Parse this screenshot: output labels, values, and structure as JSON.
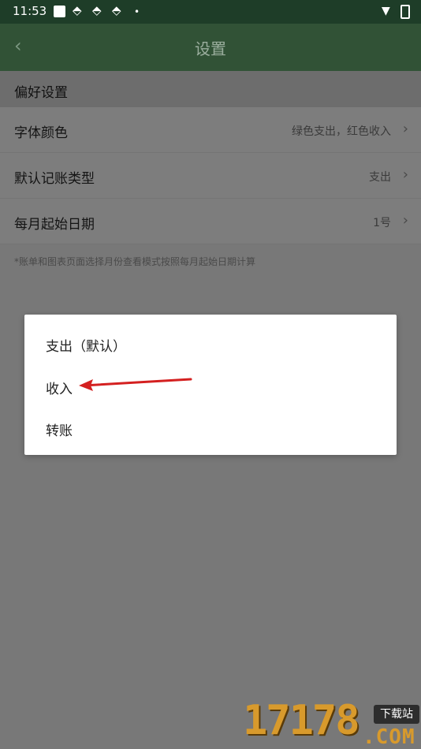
{
  "status_bar": {
    "time": "11:53",
    "icons": [
      "notification-square-icon",
      "app-icon",
      "app-icon",
      "app-icon",
      "dot-icon",
      "wifi-icon",
      "battery-icon"
    ]
  },
  "app_bar": {
    "back_icon": "‹",
    "title": "设置"
  },
  "section": {
    "title": "偏好设置"
  },
  "settings": [
    {
      "label": "字体颜色",
      "value": "绿色支出，红色收入"
    },
    {
      "label": "默认记账类型",
      "value": "支出"
    },
    {
      "label": "每月起始日期",
      "value": "1号"
    }
  ],
  "chevron": "›",
  "note": "*账单和图表页面选择月份查看模式按照每月起始日期计算",
  "dialog": {
    "options": [
      "支出（默认）",
      "收入",
      "转账"
    ]
  },
  "annotation": {
    "arrow_color": "#d42020"
  },
  "watermark": {
    "number": "17178",
    "badge": "下载站",
    "domain": ".COM"
  }
}
